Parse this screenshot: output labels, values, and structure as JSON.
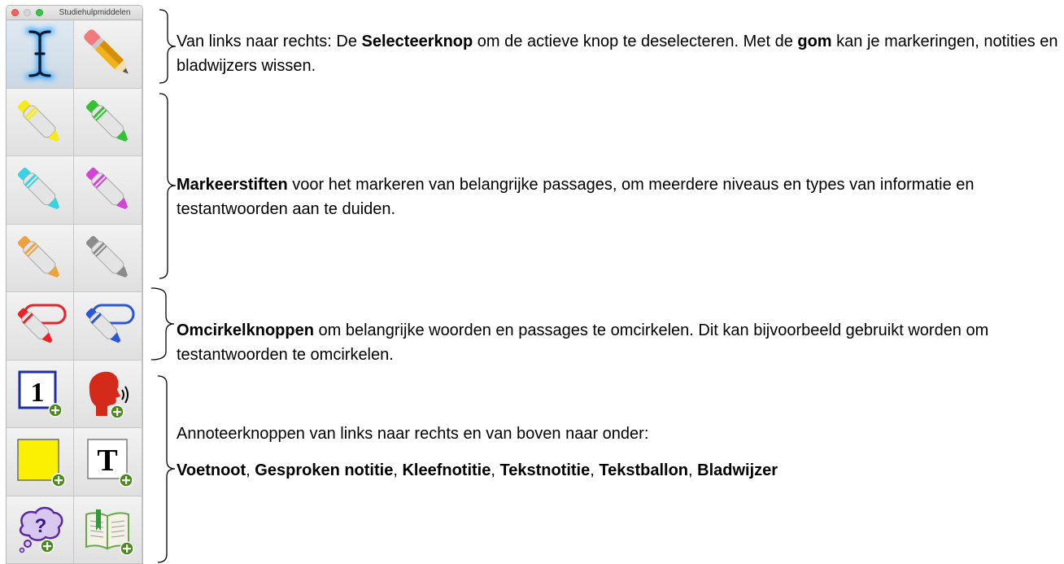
{
  "window": {
    "title": "Studiehulpmiddelen"
  },
  "palette": {
    "tools": [
      {
        "name": "Selecteerknop",
        "icon": "text-cursor-select-icon",
        "selected": true
      },
      {
        "name": "Gom",
        "icon": "eraser-pencil-icon"
      },
      {
        "name": "Markeerstift geel",
        "icon": "highlighter-yellow-icon",
        "color": "#f5ea1c"
      },
      {
        "name": "Markeerstift groen",
        "icon": "highlighter-green-icon",
        "color": "#35c035"
      },
      {
        "name": "Markeerstift cyaan",
        "icon": "highlighter-cyan-icon",
        "color": "#34d3e6"
      },
      {
        "name": "Markeerstift magenta",
        "icon": "highlighter-magenta-icon",
        "color": "#d641d8"
      },
      {
        "name": "Markeerstift oranje",
        "icon": "highlighter-orange-icon",
        "color": "#f0a23a"
      },
      {
        "name": "Markeerstift grijs",
        "icon": "highlighter-gray-icon",
        "color": "#8b8b8b"
      },
      {
        "name": "Omcirkelknop rood",
        "icon": "circle-marker-red-icon",
        "color": "#e8232a"
      },
      {
        "name": "Omcirkelknop blauw",
        "icon": "circle-marker-blue-icon",
        "color": "#2a56d8"
      },
      {
        "name": "Voetnoot",
        "icon": "footnote-icon",
        "label": "1"
      },
      {
        "name": "Gesproken notitie",
        "icon": "spoken-note-icon"
      },
      {
        "name": "Kleefnotitie",
        "icon": "sticky-note-icon"
      },
      {
        "name": "Tekstnotitie",
        "icon": "text-note-icon",
        "label": "T"
      },
      {
        "name": "Tekstballon",
        "icon": "text-balloon-icon",
        "label": "?"
      },
      {
        "name": "Bladwijzer",
        "icon": "bookmark-icon"
      }
    ]
  },
  "descriptions": {
    "select_eraser": {
      "t1": "Van links naar rechts: De ",
      "b1": "Selecteerknop",
      "t2": " om de actieve knop te deselecteren. Met de ",
      "b2": "gom",
      "t3": " kan je markeringen, notities en bladwijzers wissen."
    },
    "highlighters": {
      "b1": "Markeerstiften",
      "t1": " voor het markeren van belangrijke passages, om meerdere niveaus en types van informatie en testantwoorden aan te duiden."
    },
    "circle_tools": {
      "b1": "Omcirkelknoppen",
      "t1": " om belangrijke woorden en passages te omcirkelen. Dit kan bijvoorbeeld gebruikt worden om testantwoorden te omcirkelen."
    },
    "annotations": {
      "line1": "Annoteerknoppen van links naar rechts en van boven naar onder:",
      "b1": "Voetnoot",
      "s1": ", ",
      "b2": "Gesproken notitie",
      "s2": ", ",
      "b3": "Kleefnotitie",
      "s3": ", ",
      "b4": "Tekstnotitie",
      "s4": ", ",
      "b5": "Tekstballon",
      "s5": ", ",
      "b6": "Bladwijzer"
    }
  },
  "colors": {
    "window_bg": "#e6e6e6",
    "select_glow": "#33a6ff",
    "plus_badge": "#4d8a1d"
  }
}
